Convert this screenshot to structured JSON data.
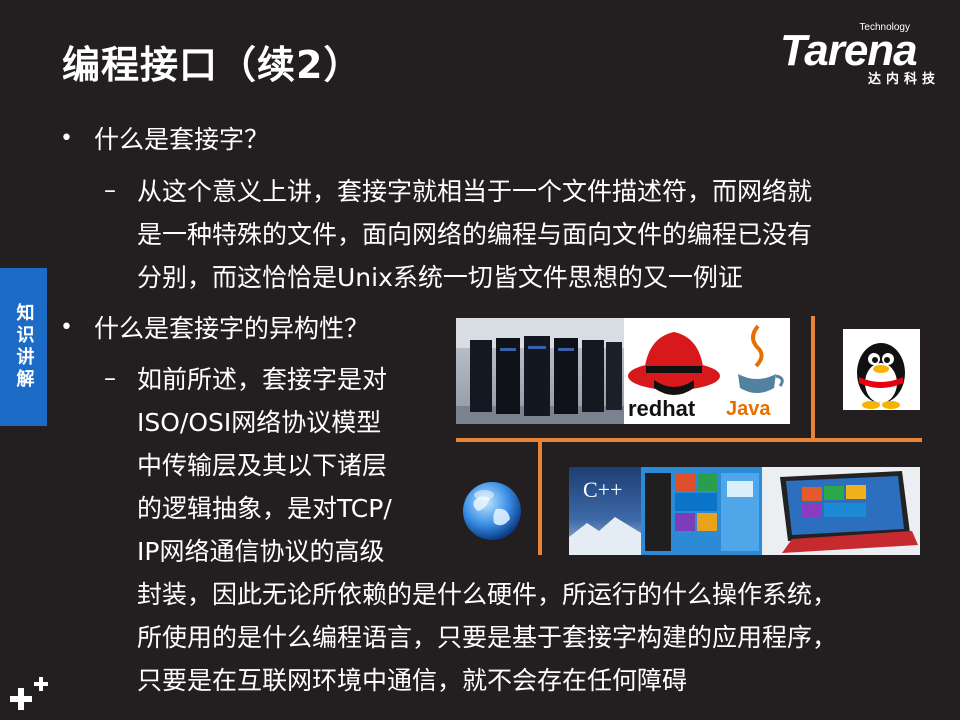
{
  "title": "编程接口（续2）",
  "logo": {
    "tech": "Technology",
    "brand": "Tarena",
    "cn": "达内科技"
  },
  "side_tab": "知识讲解",
  "q1": "什么是套接字？",
  "a1_lines": [
    "从这个意义上讲，套接字就相当于一个文件描述符，而网络就",
    "是一种特殊的文件，面向网络的编程与面向文件的编程已没有",
    "分别，而这恰恰是Unix系统一切皆文件思想的又一例证"
  ],
  "q2": "什么是套接字的异构性？",
  "a2_lines": [
    "如前所述，套接字是对",
    "ISO/OSI网络协议模型",
    "中传输层及其以下诸层",
    "的逻辑抽象，是对TCP/",
    "IP网络通信协议的高级",
    "封装，因此无论所依赖的是什么硬件，所运行的什么操作系统，",
    "所使用的是什么编程语言，只要是基于套接字构建的应用程序，",
    "只要是在互联网环境中通信，就不会存在任何障碍"
  ],
  "images": {
    "redhat_text": "redhat",
    "java_text": "Java",
    "cpp_text": "C++"
  },
  "colors": {
    "background": "#231f20",
    "accent": "#1b6bc7",
    "connector": "#e8843a"
  }
}
